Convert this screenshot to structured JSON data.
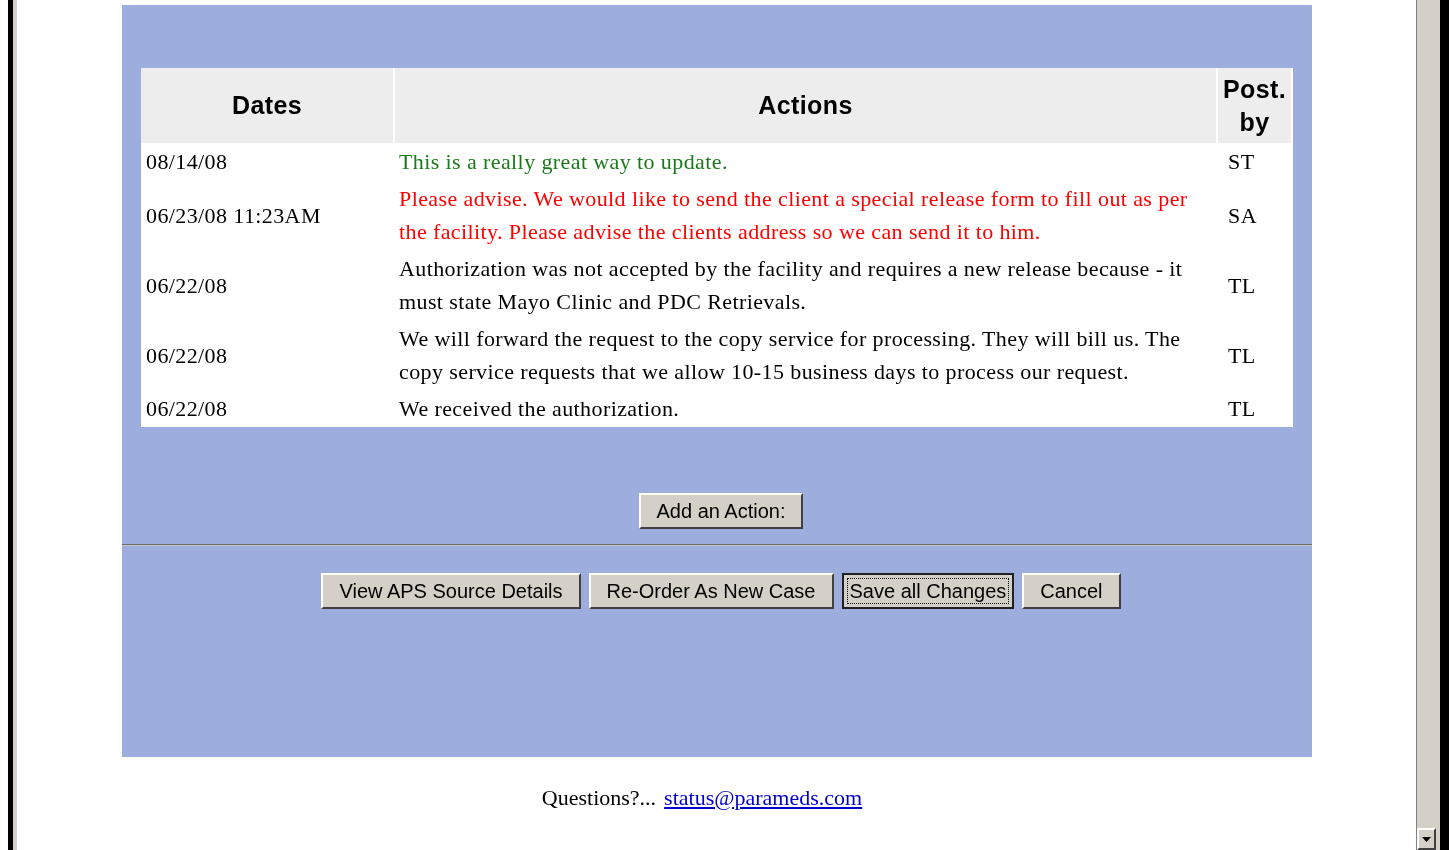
{
  "table": {
    "columns": [
      "Dates",
      "Actions",
      "Post. by"
    ],
    "rows": [
      {
        "date": "08/14/08",
        "action": "This is a really great way to update.",
        "posted_by": "ST",
        "color": "#1a7a1a"
      },
      {
        "date": "06/23/08 11:23AM",
        "action": "Please advise. We would like to send the client a special release form to fill out as per the facility. Please advise the clients address so we can send it to him.",
        "posted_by": "SA",
        "color": "#ff0000"
      },
      {
        "date": "06/22/08",
        "action": "Authorization was not accepted by the facility and requires a new release because - it must state Mayo Clinic and PDC Retrievals.",
        "posted_by": "TL",
        "color": "#000000"
      },
      {
        "date": "06/22/08",
        "action": "We will forward the request to the copy service for processing. They will bill us. The copy service requests that we allow 10-15 business days to process our request.",
        "posted_by": "TL",
        "color": "#000000"
      },
      {
        "date": "06/22/08",
        "action": "We received the authorization.",
        "posted_by": "TL",
        "color": "#000000"
      }
    ]
  },
  "add_button": "Add an Action:",
  "buttons": [
    {
      "label": "View APS Source Details",
      "focused": false
    },
    {
      "label": "Re-Order As New Case",
      "focused": false
    },
    {
      "label": "Save all Changes",
      "focused": true
    },
    {
      "label": "Cancel",
      "focused": false
    }
  ],
  "footer": {
    "text": "Questions?...",
    "link": "status@parameds.com"
  }
}
